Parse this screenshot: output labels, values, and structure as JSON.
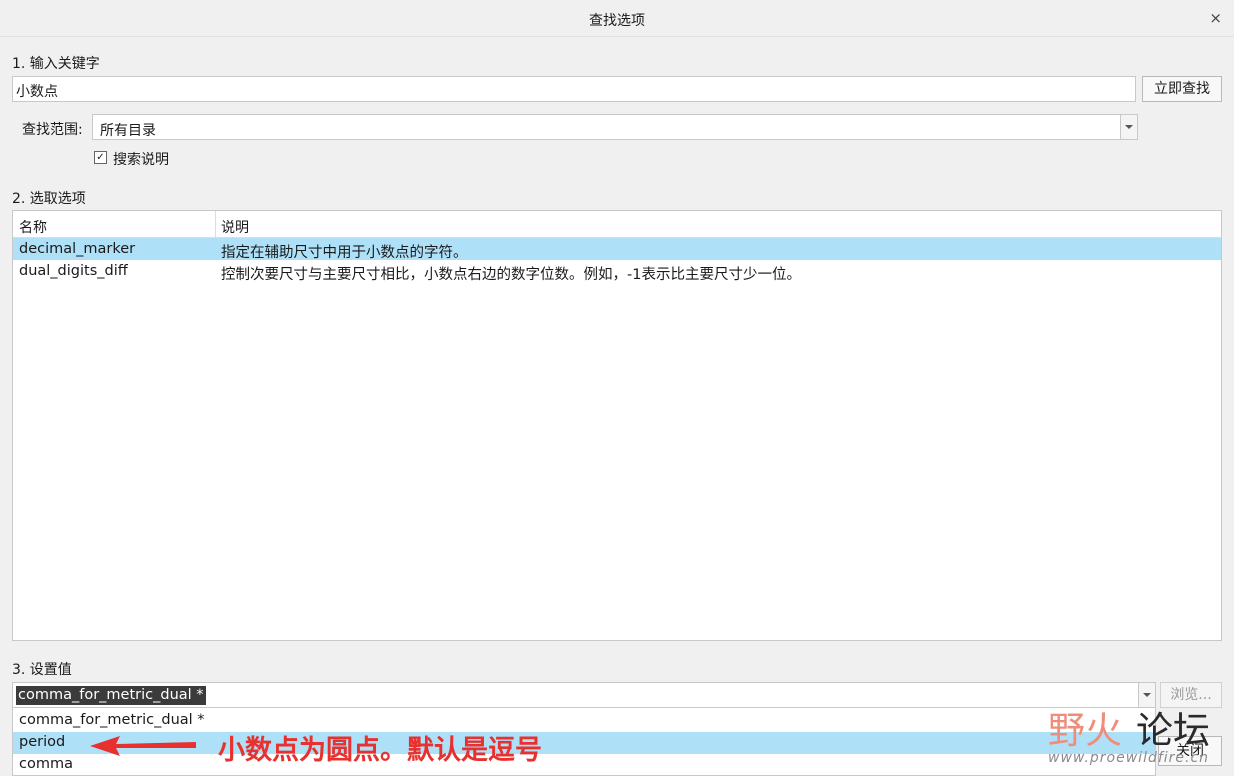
{
  "window": {
    "title": "查找选项",
    "close_label": "×"
  },
  "step1": {
    "label": "1.  输入关键字",
    "keyword_value": "小数点",
    "search_button": "立即查找",
    "scope_label": "查找范围:",
    "scope_value": "所有目录",
    "search_desc_label": "搜索说明",
    "search_desc_checked": true
  },
  "step2": {
    "label": "2.  选取选项",
    "columns": [
      "名称",
      "说明"
    ],
    "rows": [
      {
        "name": "decimal_marker",
        "desc": "指定在辅助尺寸中用于小数点的字符。",
        "selected": true
      },
      {
        "name": "dual_digits_diff",
        "desc": "控制次要尺寸与主要尺寸相比，小数点右边的数字位数。例如，-1表示比主要尺寸少一位。",
        "selected": false
      }
    ]
  },
  "step3": {
    "label": "3.  设置值",
    "current_value": "comma_for_metric_dual *",
    "browse_button": "浏览...",
    "options": [
      {
        "label": "comma_for_metric_dual *",
        "selected": false
      },
      {
        "label": "period",
        "selected": true
      },
      {
        "label": "comma",
        "selected": false
      }
    ]
  },
  "footer": {
    "close_button": "关闭"
  },
  "annotation": {
    "text": "小数点为圆点。默认是逗号",
    "color": "#e8312f"
  },
  "watermark": {
    "text1": "野火",
    "text2": "论坛",
    "url": "www.proewildfire.cn"
  }
}
